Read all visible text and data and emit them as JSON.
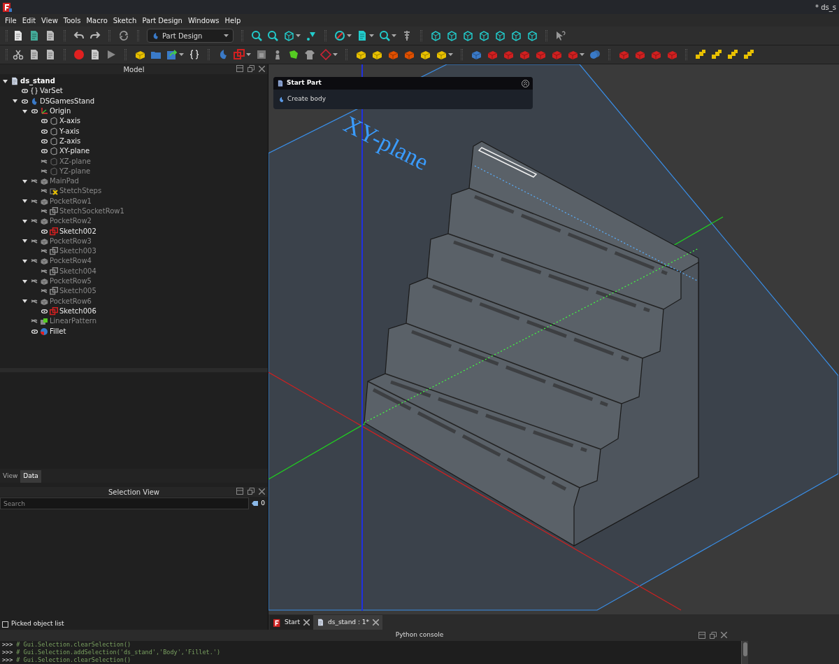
{
  "window": {
    "title": "* ds_s"
  },
  "menu": [
    "File",
    "Edit",
    "View",
    "Tools",
    "Macro",
    "Sketch",
    "Part Design",
    "Windows",
    "Help"
  ],
  "workbench": {
    "value": "Part Design"
  },
  "model_panel": {
    "title": "Model"
  },
  "tree": [
    {
      "label": "ds_stand",
      "kind": "document",
      "expanded": true,
      "children": [
        {
          "label": "VarSet",
          "kind": "varset",
          "visible": true
        },
        {
          "label": "DSGamesStand",
          "kind": "body",
          "visible": true,
          "expanded": true,
          "children": [
            {
              "label": "Origin",
              "kind": "origin",
              "visible": true,
              "expanded": true,
              "children": [
                {
                  "label": "X-axis",
                  "kind": "datum",
                  "visible": true
                },
                {
                  "label": "Y-axis",
                  "kind": "datum",
                  "visible": true
                },
                {
                  "label": "Z-axis",
                  "kind": "datum",
                  "visible": true
                },
                {
                  "label": "XY-plane",
                  "kind": "datum",
                  "visible": true
                },
                {
                  "label": "XZ-plane",
                  "kind": "datum",
                  "visible": false
                },
                {
                  "label": "YZ-plane",
                  "kind": "datum",
                  "visible": false
                }
              ]
            },
            {
              "label": "MainPad",
              "kind": "pad",
              "visible": false,
              "expanded": true,
              "children": [
                {
                  "label": "StetchSteps",
                  "kind": "sketch-error",
                  "visible": false
                }
              ]
            },
            {
              "label": "PocketRow1",
              "kind": "pocket",
              "visible": false,
              "expanded": true,
              "children": [
                {
                  "label": "StetchSocketRow1",
                  "kind": "sketch",
                  "visible": false
                }
              ]
            },
            {
              "label": "PocketRow2",
              "kind": "pocket",
              "visible": false,
              "expanded": true,
              "children": [
                {
                  "label": "Sketch002",
                  "kind": "sketch",
                  "visible": true
                }
              ]
            },
            {
              "label": "PocketRow3",
              "kind": "pocket",
              "visible": false,
              "expanded": true,
              "children": [
                {
                  "label": "Sketch003",
                  "kind": "sketch",
                  "visible": false
                }
              ]
            },
            {
              "label": "PocketRow4",
              "kind": "pocket",
              "visible": false,
              "expanded": true,
              "children": [
                {
                  "label": "Sketch004",
                  "kind": "sketch",
                  "visible": false
                }
              ]
            },
            {
              "label": "PocketRow5",
              "kind": "pocket",
              "visible": false,
              "expanded": true,
              "children": [
                {
                  "label": "Sketch005",
                  "kind": "sketch",
                  "visible": false
                }
              ]
            },
            {
              "label": "PocketRow6",
              "kind": "pocket",
              "visible": false,
              "expanded": true,
              "children": [
                {
                  "label": "Sketch006",
                  "kind": "sketch",
                  "visible": true
                }
              ]
            },
            {
              "label": "LinearPattern",
              "kind": "pattern",
              "visible": false
            },
            {
              "label": "Fillet",
              "kind": "fillet",
              "visible": true
            }
          ]
        }
      ]
    }
  ],
  "property_tabs": [
    {
      "label": "View",
      "selected": false
    },
    {
      "label": "Data",
      "selected": true
    }
  ],
  "selection_view": {
    "title": "Selection View",
    "search": {
      "placeholder": "Search"
    },
    "count": "0",
    "picked_list": {
      "label": "Picked object list",
      "checked": false
    }
  },
  "viewport": {
    "plane_label": "XY-plane",
    "task_panel": {
      "title": "Start Part",
      "action": "Create body"
    }
  },
  "doc_tabs": [
    {
      "label": "Start",
      "selected": false,
      "kind": "start"
    },
    {
      "label": "ds_stand : 1*",
      "selected": true,
      "kind": "document"
    }
  ],
  "console": {
    "title": "Python console",
    "lines": [
      {
        "prompt": ">>>",
        "code": "# Gui.Selection.clearSelection()"
      },
      {
        "prompt": ">>>",
        "code": "# Gui.Selection.addSelection('ds_stand','Body','Fillet.')"
      },
      {
        "prompt": ">>>",
        "code": "# Gui.Selection.clearSelection()"
      }
    ]
  }
}
